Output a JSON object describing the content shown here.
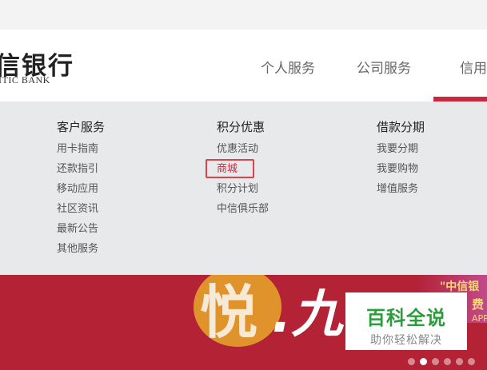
{
  "header": {
    "logo_cn": "信银行",
    "logo_en": "ITIC BANK",
    "nav": [
      {
        "label": "个人服务"
      },
      {
        "label": "公司服务"
      },
      {
        "label": "信用"
      }
    ],
    "accent_color": "#c8283c"
  },
  "menu": {
    "columns": [
      {
        "title": "客户服务",
        "items": [
          "用卡指南",
          "还款指引",
          "移动应用",
          "社区资讯",
          "最新公告",
          "其他服务"
        ]
      },
      {
        "title": "积分优惠",
        "items": [
          "优惠活动",
          "商城",
          "积分计划",
          "中信俱乐部"
        ]
      },
      {
        "title": "借款分期",
        "items": [
          "我要分期",
          "我要购物",
          "增值服务"
        ]
      }
    ],
    "highlighted_item": "商城"
  },
  "banner": {
    "text1": "\"中信银",
    "text2": "费",
    "text3": "APP",
    "carousel_dots": 6,
    "active_dot": 2
  },
  "watermark": {
    "title": "百科全说",
    "subtitle": "助你轻松解决"
  }
}
